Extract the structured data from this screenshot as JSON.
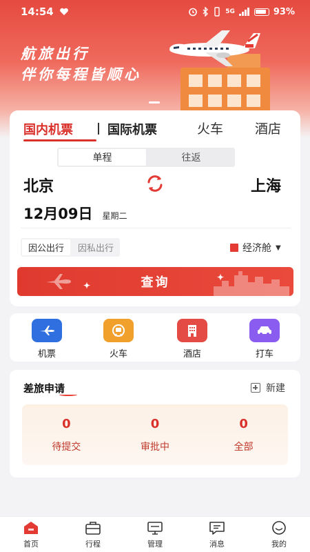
{
  "status_bar": {
    "time": "14:54",
    "network": "5G",
    "battery": "93%"
  },
  "hero": {
    "slogan_line1": "航旅出行",
    "slogan_line2": "伴你每程皆顺心"
  },
  "booking": {
    "tabs": [
      "国内机票",
      "国际机票",
      "火车",
      "酒店"
    ],
    "active_tab": "国内机票",
    "trip_types": [
      "单程",
      "往返"
    ],
    "active_trip_type": "单程",
    "from_city": "北京",
    "to_city": "上海",
    "date": "12月09日",
    "weekday": "星期二",
    "purposes": [
      "因公出行",
      "因私出行"
    ],
    "active_purpose": "因公出行",
    "cabin": "经济舱",
    "search_label": "查询"
  },
  "services": [
    {
      "label": "机票",
      "icon": "plane-ticket-icon",
      "color": "#2f6fe0"
    },
    {
      "label": "火车",
      "icon": "train-icon",
      "color": "#f0a02b"
    },
    {
      "label": "酒店",
      "icon": "hotel-icon",
      "color": "#e54b45"
    },
    {
      "label": "打车",
      "icon": "taxi-icon",
      "color": "#8a5cf0"
    }
  ],
  "approvals": {
    "title": "差旅申请",
    "new_label": "新建",
    "stats": [
      {
        "value": "0",
        "label": "待提交"
      },
      {
        "value": "0",
        "label": "审批中"
      },
      {
        "value": "0",
        "label": "全部"
      }
    ]
  },
  "nav": [
    {
      "label": "首页",
      "icon": "home-icon"
    },
    {
      "label": "行程",
      "icon": "luggage-icon"
    },
    {
      "label": "管理",
      "icon": "monitor-icon"
    },
    {
      "label": "消息",
      "icon": "message-icon"
    },
    {
      "label": "我的",
      "icon": "profile-icon"
    }
  ],
  "colors": {
    "brand_red": "#d9302a",
    "hero_top": "#e64a3f"
  }
}
